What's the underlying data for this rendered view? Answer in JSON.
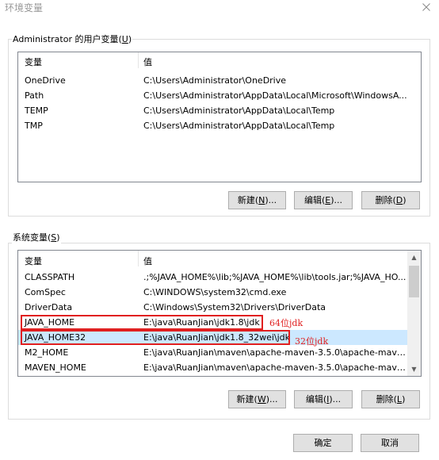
{
  "window": {
    "title": "环境变量",
    "close_icon": "close-icon"
  },
  "user_vars": {
    "legend_text": "Administrator 的用户变量(",
    "legend_key": "U",
    "legend_end": ")",
    "columns": {
      "name": "变量",
      "value": "值"
    },
    "rows": [
      {
        "name": "OneDrive",
        "value": "C:\\Users\\Administrator\\OneDrive"
      },
      {
        "name": "Path",
        "value": "C:\\Users\\Administrator\\AppData\\Local\\Microsoft\\WindowsA..."
      },
      {
        "name": "TEMP",
        "value": "C:\\Users\\Administrator\\AppData\\Local\\Temp"
      },
      {
        "name": "TMP",
        "value": "C:\\Users\\Administrator\\AppData\\Local\\Temp"
      }
    ],
    "buttons": {
      "new": {
        "text": "新建(",
        "key": "N",
        "end": ")..."
      },
      "edit": {
        "text": "编辑(",
        "key": "E",
        "end": ")..."
      },
      "delete": {
        "text": "删除(",
        "key": "D",
        "end": ")"
      }
    }
  },
  "system_vars": {
    "legend_text": "系统变量(",
    "legend_key": "S",
    "legend_end": ")",
    "columns": {
      "name": "变量",
      "value": "值"
    },
    "rows": [
      {
        "name": "CLASSPATH",
        "value": ".;%JAVA_HOME%\\lib;%JAVA_HOME%\\lib\\tools.jar;%JAVA_HO..."
      },
      {
        "name": "ComSpec",
        "value": "C:\\WINDOWS\\system32\\cmd.exe"
      },
      {
        "name": "DriverData",
        "value": "C:\\Windows\\System32\\Drivers\\DriverData"
      },
      {
        "name": "JAVA_HOME",
        "value": "E:\\java\\RuanJian\\jdk1.8\\jdk"
      },
      {
        "name": "JAVA_HOME32",
        "value": "E:\\java\\RuanJian\\jdk1.8_32wei\\jdk"
      },
      {
        "name": "M2_HOME",
        "value": "E:\\java\\RuanJian\\maven\\apache-maven-3.5.0\\apache-maven-..."
      },
      {
        "name": "MAVEN_HOME",
        "value": "E:\\java\\RuanJian\\maven\\apache-maven-3.5.0\\apache-maven-..."
      }
    ],
    "buttons": {
      "new": {
        "text": "新建(",
        "key": "W",
        "end": ")..."
      },
      "edit": {
        "text": "编辑(",
        "key": "I",
        "end": ")..."
      },
      "delete": {
        "text": "删除(",
        "key": "L",
        "end": ")"
      }
    },
    "annotations": {
      "java_home": "64位jdk",
      "java_home32": "32位jdk"
    }
  },
  "dialog_buttons": {
    "ok": "确定",
    "cancel": "取消"
  },
  "colors": {
    "selection": "#cce8ff",
    "annotation_red": "#e02020",
    "button_face": "#e1e1e1"
  }
}
